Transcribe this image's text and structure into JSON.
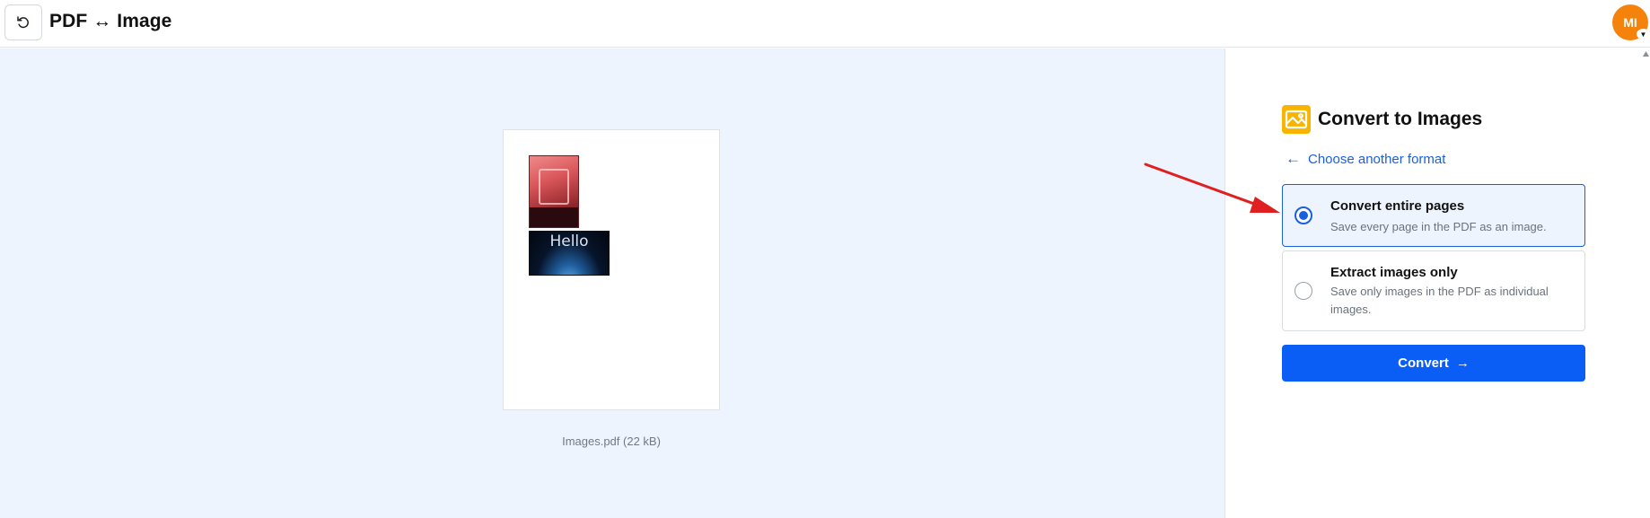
{
  "header": {
    "title": "PDF ↔ Image",
    "back_icon": "rotate-ccw-icon",
    "avatar_initials": "MI",
    "avatar_color": "#f5820b"
  },
  "preview": {
    "thumbnail_hello_text": "Hello",
    "file_label": "Images.pdf (22 kB)",
    "background_color": "#eef4fd"
  },
  "panel": {
    "title": "Convert to Images",
    "title_icon": "image-icon",
    "back_link_label": "Choose another format",
    "options": [
      {
        "title": "Convert entire pages",
        "description": "Save every page in the PDF as an image.",
        "selected": true
      },
      {
        "title": "Extract images only",
        "description": "Save only images in the PDF as individual images.",
        "selected": false
      }
    ],
    "convert_label": "Convert",
    "accent_color": "#0a5ef5"
  }
}
